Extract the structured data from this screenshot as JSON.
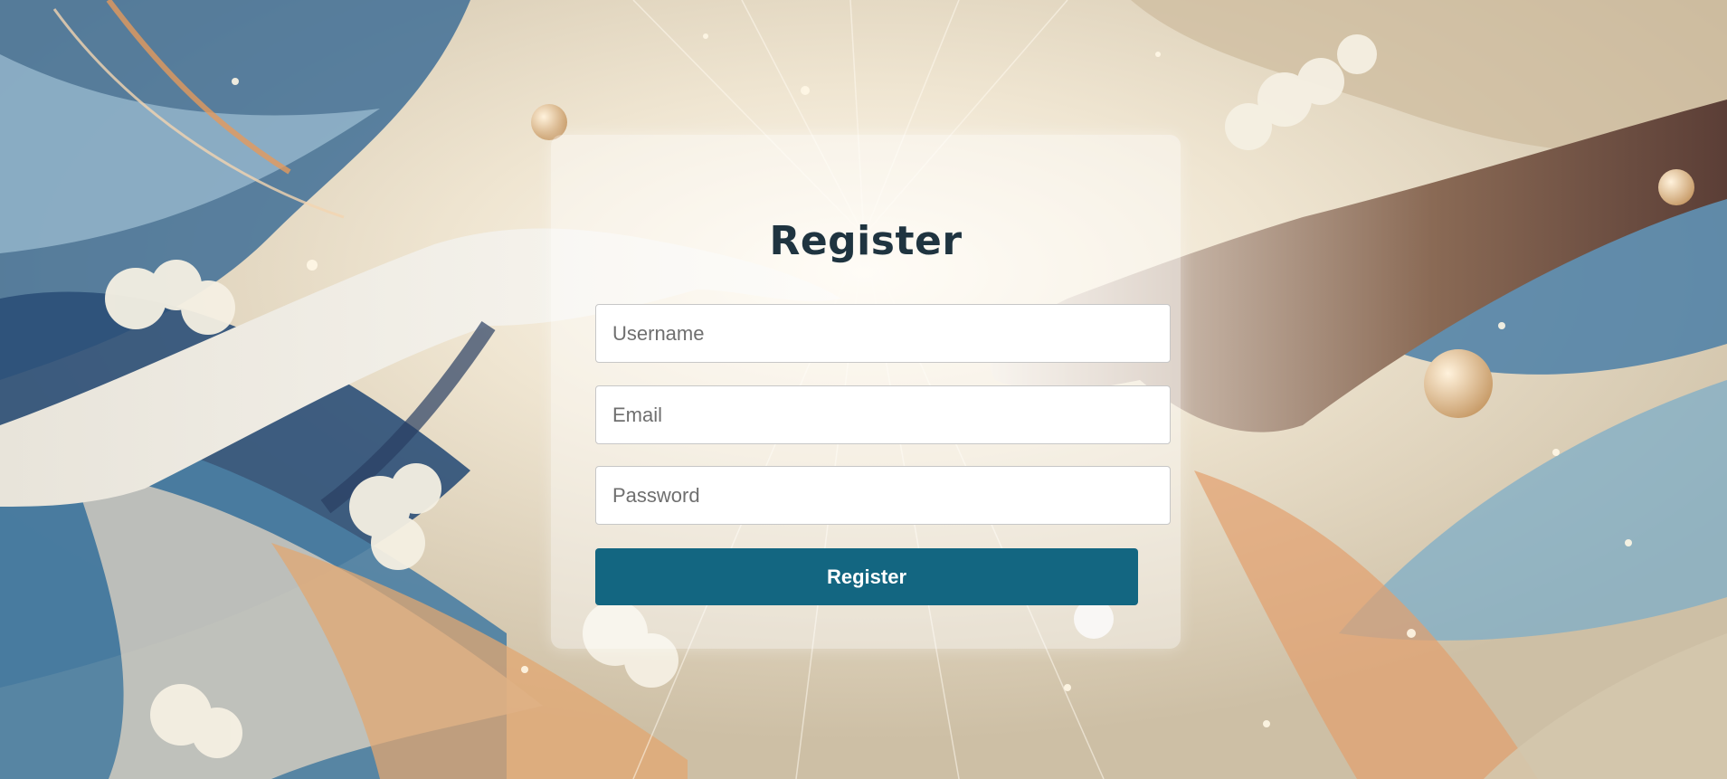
{
  "form": {
    "title": "Register",
    "username_placeholder": "Username",
    "email_placeholder": "Email",
    "password_placeholder": "Password",
    "submit_label": "Register"
  },
  "colors": {
    "accent": "#136681",
    "title": "#1f3440",
    "background_sand": "#d8ccb6",
    "background_blue": "#3e6f93"
  }
}
